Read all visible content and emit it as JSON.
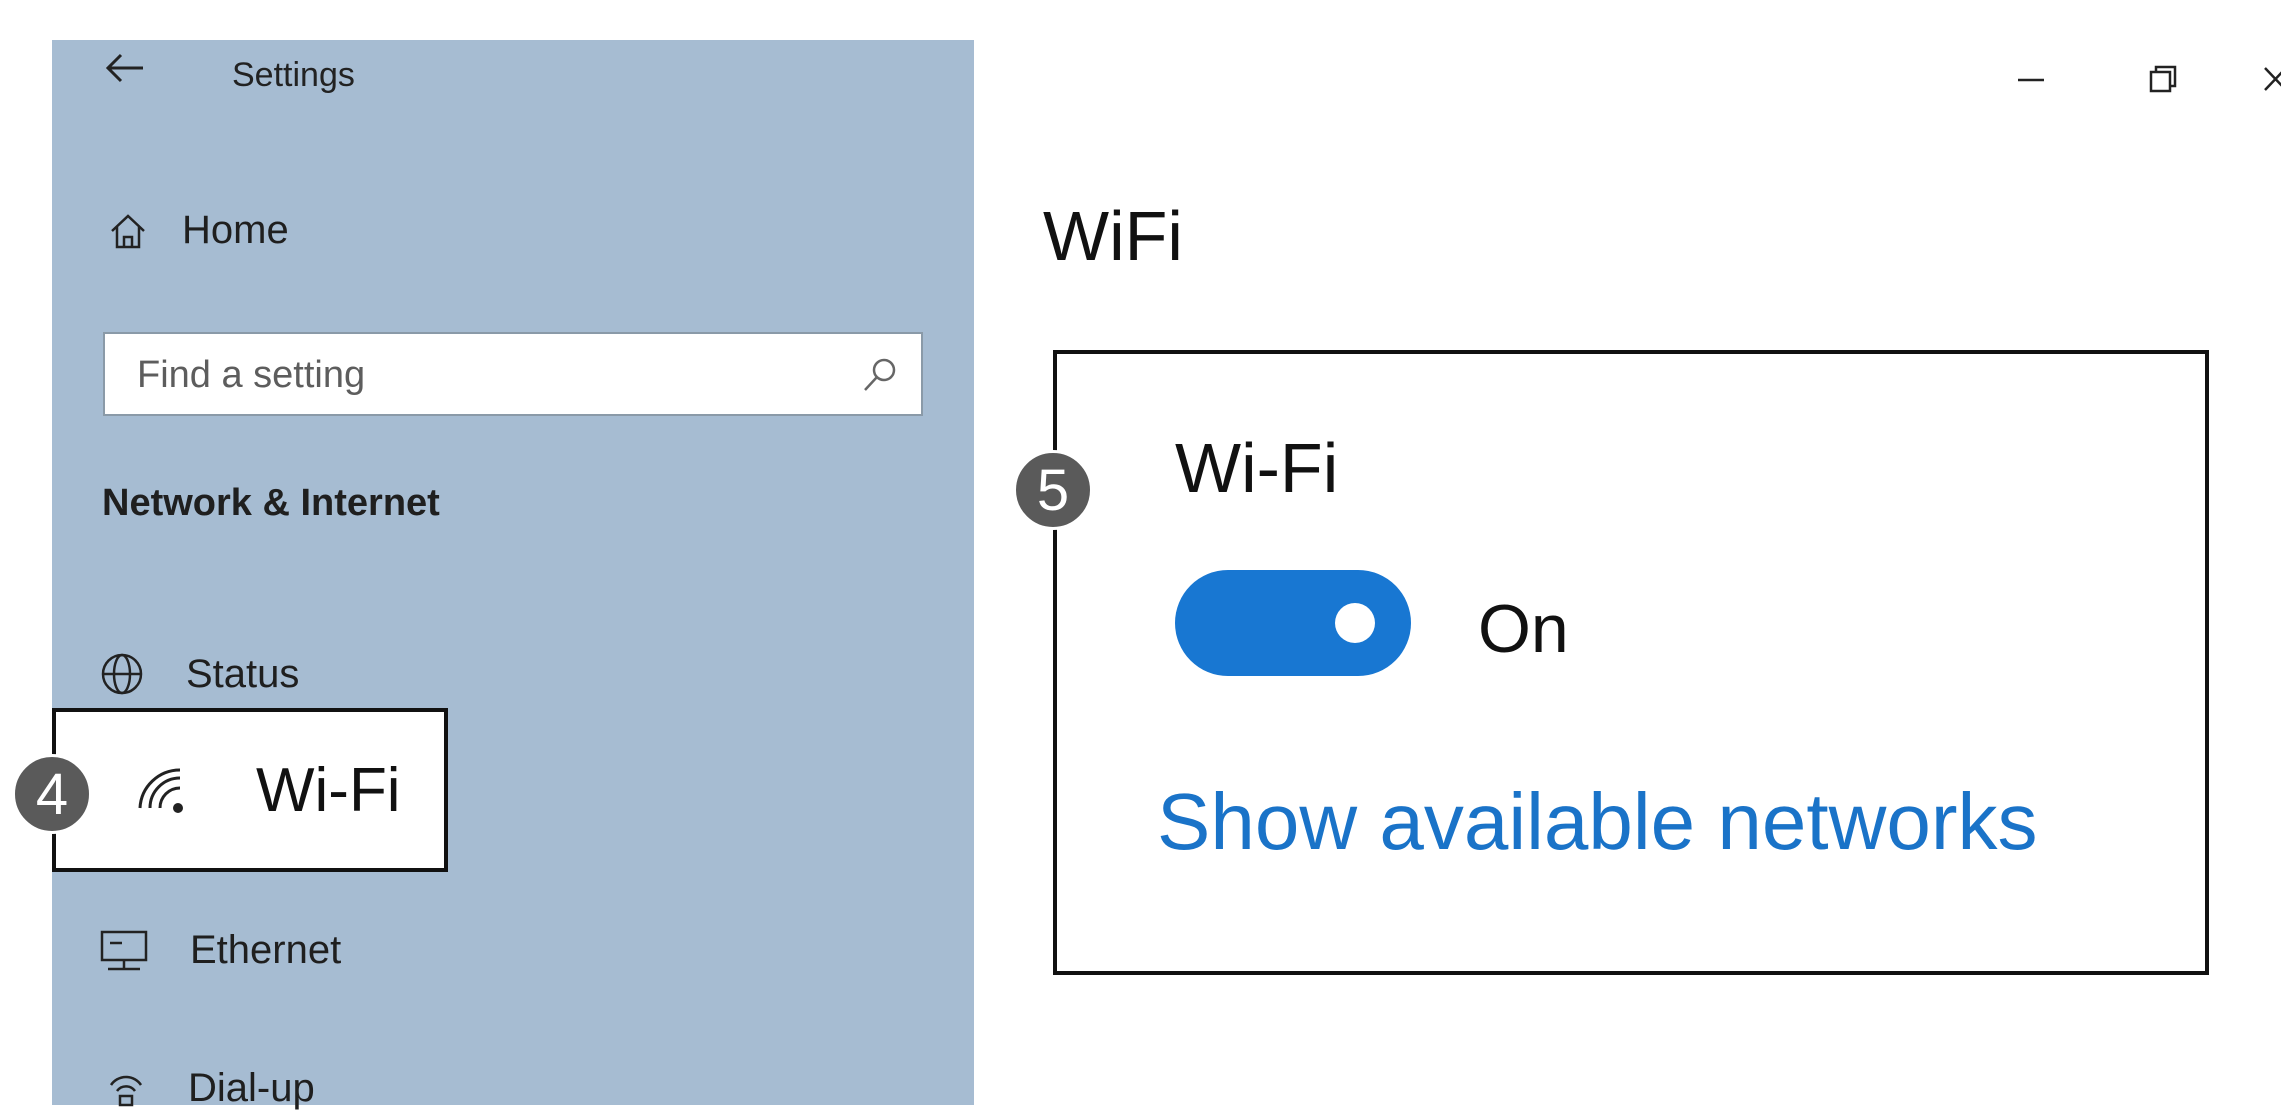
{
  "window": {
    "title": "Settings",
    "controls": [
      "minimize-icon",
      "restore-icon",
      "close-icon"
    ]
  },
  "sidebar": {
    "home_label": "Home",
    "search": {
      "placeholder": "Find a setting"
    },
    "section_heading": "Network & Internet",
    "items": [
      {
        "label": "Status",
        "icon": "globe-icon"
      },
      {
        "label": "Wi-Fi",
        "icon": "wifi-icon",
        "selected": true
      },
      {
        "label": "Ethernet",
        "icon": "ethernet-icon"
      },
      {
        "label": "Dial-up",
        "icon": "dialup-icon"
      }
    ]
  },
  "main": {
    "page_title": "WiFi",
    "panel": {
      "heading": "Wi-Fi",
      "toggle_state": "On",
      "toggle_on": true,
      "link": "Show available networks"
    }
  },
  "markers": {
    "step_4": "4",
    "step_5": "5"
  },
  "colors": {
    "sidebar_bg": "#a6bcd2",
    "accent": "#1877d2",
    "link": "#1a73c8"
  }
}
